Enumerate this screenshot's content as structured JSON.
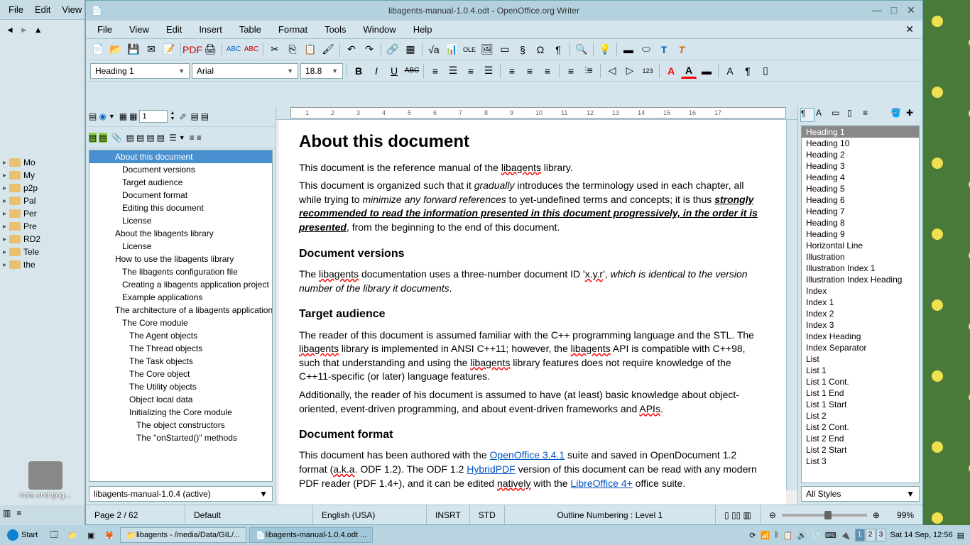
{
  "window": {
    "title": "libagents-manual-1.0.4.odt - OpenOffice.org Writer"
  },
  "filemanager": {
    "menu": [
      "File",
      "Edit",
      "View"
    ],
    "folders": [
      "Mo",
      "My",
      "p2p",
      "Pal",
      "Per",
      "Pre",
      "RD2",
      "Tele",
      "the"
    ]
  },
  "menubar": [
    "File",
    "View",
    "Edit",
    "Insert",
    "Table",
    "Format",
    "Tools",
    "Window",
    "Help"
  ],
  "format_toolbar": {
    "style": "Heading 1",
    "font": "Arial",
    "size": "18.8"
  },
  "navigator": {
    "page_input": "1",
    "items": [
      {
        "t": "About this document",
        "l": 1,
        "sel": true
      },
      {
        "t": "Document versions",
        "l": 2
      },
      {
        "t": "Target audience",
        "l": 2
      },
      {
        "t": "Document format",
        "l": 2
      },
      {
        "t": "Editing this document",
        "l": 2
      },
      {
        "t": "License",
        "l": 2
      },
      {
        "t": "About the libagents library",
        "l": 1
      },
      {
        "t": "License",
        "l": 2
      },
      {
        "t": "How to use the libagents library",
        "l": 1
      },
      {
        "t": "The libagents configuration file",
        "l": 2
      },
      {
        "t": "Creating a libagents application project",
        "l": 2
      },
      {
        "t": "Example applications",
        "l": 2
      },
      {
        "t": "The architecture of a libagents application",
        "l": 1
      },
      {
        "t": "The Core module",
        "l": 2
      },
      {
        "t": "The Agent objects",
        "l": 3
      },
      {
        "t": "The Thread objects",
        "l": 3
      },
      {
        "t": "The Task objects",
        "l": 3
      },
      {
        "t": "The Core object",
        "l": 3
      },
      {
        "t": "The Utility objects",
        "l": 3
      },
      {
        "t": "Object local data",
        "l": 3
      },
      {
        "t": "Initializing the Core module",
        "l": 3
      },
      {
        "t": "The object constructors",
        "l": 4
      },
      {
        "t": "The \"onStarted()\" methods",
        "l": 4
      }
    ],
    "doc_dropdown": "libagents-manual-1.0.4 (active)"
  },
  "document": {
    "h1": "About this document",
    "p1a": "This document is the reference manual of the ",
    "p1b": "libagents",
    "p1c": " library.",
    "p2a": "This document is organized such that it ",
    "p2b": "gradually",
    "p2c": " introduces the terminology used in each chapter, all while trying to ",
    "p2d": "minimize any forward references",
    "p2e": " to yet-undefined terms and concepts; it is thus ",
    "p2f": "strongly recommended to read the information presented in this document progressively, in the order it is presented",
    "p2g": ", from the beginning to the end of this document.",
    "h2a": "Document versions",
    "p3a": "The ",
    "p3b": "libagents",
    "p3c": " documentation uses a three-number document ID '",
    "p3d": "x.y.r",
    "p3e": "', ",
    "p3f": "which is identical to the version number of the library it documents",
    "p3g": ".",
    "h2b": "Target audience",
    "p4": "The reader of this document is assumed familiar with the C++ programming language and the STL. The ",
    "p4b": "libagents",
    "p4c": " library is implemented in ANSI C++11; however, the ",
    "p4d": "libagents",
    "p4e": " API is compatible with C++98, such that understanding and using the ",
    "p4f": "libagents",
    "p4g": " library features does not require knowledge of the C++11-specific (or later) language features.",
    "p5a": "Additionally, the reader of his document is assumed to have (at least) basic knowledge about object-oriented, event-driven programming, and about event-driven frameworks and ",
    "p5b": "APIs",
    "p5c": ".",
    "h2c": "Document format",
    "p6a": "This document has been authored with the ",
    "p6b": "OpenOffice 3.4.1",
    "p6c": " suite and saved in OpenDocument 1.2 format (",
    "p6d": "a.k.a",
    "p6e": ". ODF 1.2). The ODF 1.2 ",
    "p6f": "HybridPDF",
    "p6g": " version of this document can be read with any modern PDF reader (PDF 1.4+), and it can be edited ",
    "p6h": "natively",
    "p6i": " with the ",
    "p6j": "LibreOffice 4+",
    "p6k": " office suite."
  },
  "ruler_marks": [
    "1",
    "2",
    "3",
    "4",
    "5",
    "6",
    "7",
    "8",
    "9",
    "10",
    "11",
    "12",
    "13",
    "14",
    "15",
    "16",
    "17"
  ],
  "styles": {
    "items": [
      "Heading 1",
      "Heading 10",
      "Heading 2",
      "Heading 3",
      "Heading 4",
      "Heading 5",
      "Heading 6",
      "Heading 7",
      "Heading 8",
      "Heading 9",
      "Horizontal Line",
      "Illustration",
      "Illustration Index 1",
      "Illustration Index Heading",
      "Index",
      "Index 1",
      "Index 2",
      "Index 3",
      "Index Heading",
      "Index Separator",
      "List",
      "List 1",
      "List 1 Cont.",
      "List 1 End",
      "List 1 Start",
      "List 2",
      "List 2 Cont.",
      "List 2 End",
      "List 2 Start",
      "List 3"
    ],
    "filter": "All Styles"
  },
  "status": {
    "page": "Page 2 / 62",
    "style": "Default",
    "lang": "English (USA)",
    "insert": "INSRT",
    "sel": "STD",
    "outline": "Outline Numbering : Level 1",
    "zoom": "99%"
  },
  "taskbar": {
    "start": "Start",
    "tasks": [
      "libagents - /media/Data/GIL/...",
      "libagents-manual-1.0.4.odt ..."
    ],
    "workspaces": [
      "1",
      "2",
      "3"
    ],
    "clock": "Sat 14 Sep, 12:56"
  },
  "desktop": {
    "icon1": "cats and gog..."
  }
}
